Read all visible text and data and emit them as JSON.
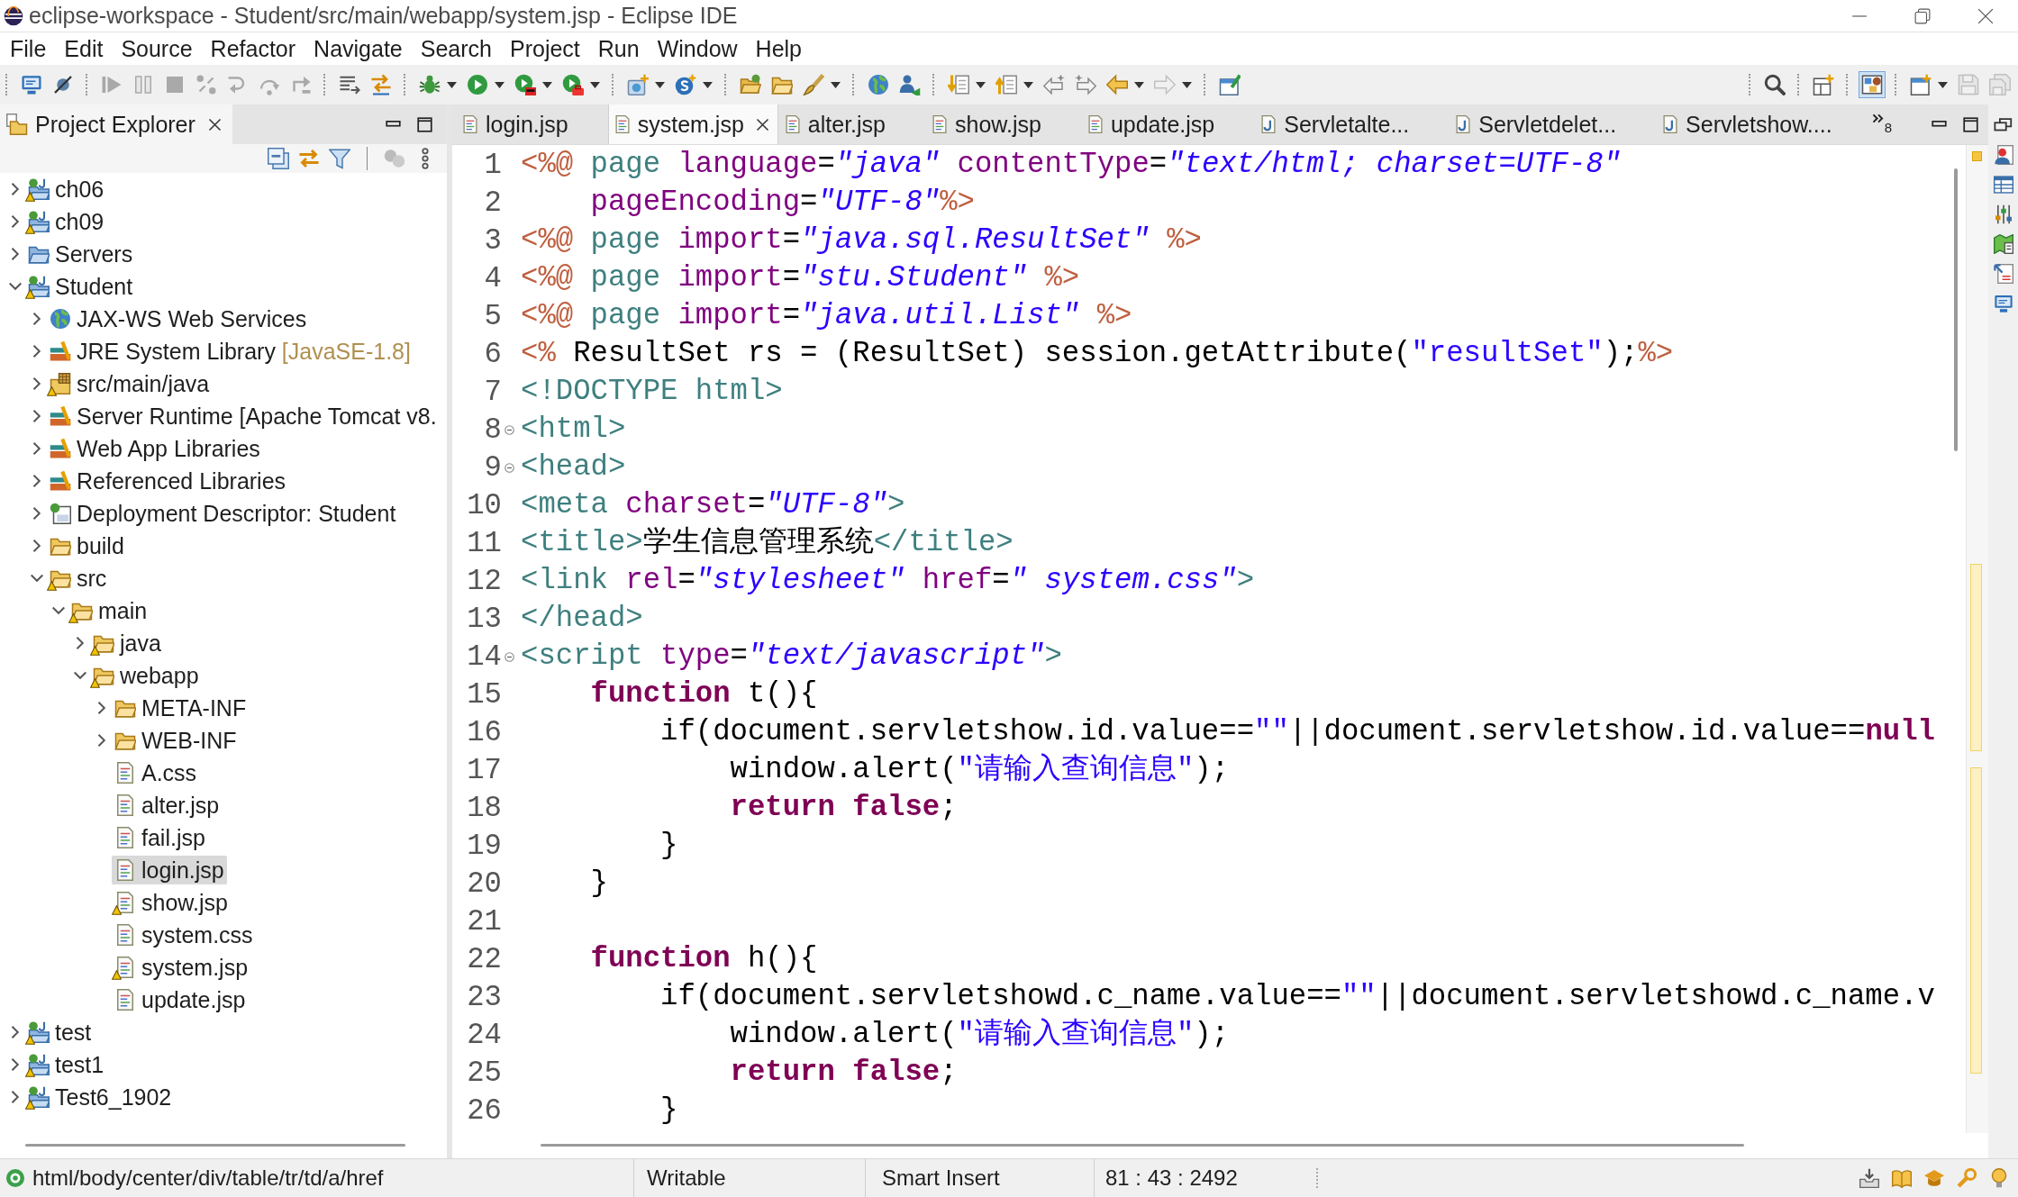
{
  "window": {
    "title": "eclipse-workspace - Student/src/main/webapp/system.jsp - Eclipse IDE"
  },
  "menu": [
    "File",
    "Edit",
    "Source",
    "Refactor",
    "Navigate",
    "Search",
    "Project",
    "Run",
    "Window",
    "Help"
  ],
  "toolbar": {
    "left": [
      [
        {
          "kind": "console",
          "disabled": false,
          "dropdown": false
        },
        {
          "kind": "skip-breakpoints",
          "disabled": false,
          "dropdown": false
        }
      ],
      [
        {
          "kind": "resume",
          "disabled": true,
          "dropdown": false
        },
        {
          "kind": "suspend",
          "disabled": true,
          "dropdown": false
        },
        {
          "kind": "terminate",
          "disabled": true,
          "dropdown": false
        },
        {
          "kind": "disconnect",
          "disabled": true,
          "dropdown": false
        },
        {
          "kind": "step-into",
          "disabled": true,
          "dropdown": false
        },
        {
          "kind": "step-over",
          "disabled": true,
          "dropdown": false
        },
        {
          "kind": "step-return",
          "disabled": true,
          "dropdown": false
        }
      ],
      [
        {
          "kind": "lines-arrow",
          "disabled": false,
          "dropdown": false
        },
        {
          "kind": "filter-arrows",
          "disabled": false,
          "dropdown": false
        }
      ],
      [
        {
          "kind": "debug",
          "disabled": false,
          "dropdown": true
        },
        {
          "kind": "run",
          "disabled": false,
          "dropdown": true
        },
        {
          "kind": "coverage",
          "disabled": false,
          "dropdown": true
        },
        {
          "kind": "tools",
          "disabled": false,
          "dropdown": true
        }
      ],
      [
        {
          "kind": "new-server",
          "disabled": false,
          "dropdown": true
        },
        {
          "kind": "new-s",
          "disabled": false,
          "dropdown": true
        }
      ],
      [
        {
          "kind": "folder-open",
          "disabled": false,
          "dropdown": false
        },
        {
          "kind": "folder",
          "disabled": false,
          "dropdown": false
        },
        {
          "kind": "brush",
          "disabled": false,
          "dropdown": true
        }
      ],
      [
        {
          "kind": "globe",
          "disabled": false,
          "dropdown": false
        },
        {
          "kind": "person-search",
          "disabled": false,
          "dropdown": false
        }
      ],
      [
        {
          "kind": "annot-down",
          "disabled": false,
          "dropdown": true
        },
        {
          "kind": "annot-up",
          "disabled": false,
          "dropdown": true
        },
        {
          "kind": "edit-back",
          "disabled": false,
          "dropdown": false
        },
        {
          "kind": "edit-fwd",
          "disabled": false,
          "dropdown": false
        },
        {
          "kind": "back",
          "disabled": false,
          "dropdown": true
        },
        {
          "kind": "forward",
          "disabled": true,
          "dropdown": true
        }
      ],
      [
        {
          "kind": "pin-window",
          "disabled": false,
          "dropdown": false
        }
      ]
    ],
    "right": [
      [
        {
          "kind": "search",
          "disabled": false,
          "dropdown": false,
          "selected": false
        }
      ],
      [
        {
          "kind": "perspective-open",
          "disabled": false,
          "dropdown": false,
          "selected": false
        }
      ],
      [
        {
          "kind": "jee",
          "disabled": false,
          "dropdown": false,
          "selected": true
        }
      ],
      [
        {
          "kind": "java-persp",
          "disabled": false,
          "dropdown": true,
          "selected": false
        },
        {
          "kind": "save",
          "disabled": true,
          "dropdown": false,
          "selected": false
        },
        {
          "kind": "save-all",
          "disabled": true,
          "dropdown": false,
          "selected": false
        }
      ]
    ]
  },
  "project_explorer": {
    "title": "Project Explorer"
  },
  "panel_toolbar": [
    [
      {
        "kind": "collapse-all",
        "disabled": false
      },
      {
        "kind": "link",
        "disabled": false
      },
      {
        "kind": "filter",
        "disabled": false
      }
    ],
    [
      {
        "kind": "sync",
        "disabled": true
      },
      {
        "kind": "view-menu",
        "disabled": false
      }
    ]
  ],
  "tree": [
    {
      "label": "ch06",
      "kind": "project",
      "warning": true,
      "expanded": false,
      "selected": false
    },
    {
      "label": "ch09",
      "kind": "project",
      "warning": true,
      "expanded": false,
      "selected": false
    },
    {
      "label": "Servers",
      "kind": "servers",
      "warning": false,
      "expanded": false,
      "selected": false
    },
    {
      "label": "Student",
      "kind": "project",
      "warning": true,
      "expanded": true,
      "selected": false,
      "children": [
        {
          "label": "JAX-WS Web Services",
          "kind": "web-services",
          "warning": false,
          "expanded": false,
          "selected": false
        },
        {
          "label": "JRE System Library",
          "decoration": "[JavaSE-1.8]",
          "kind": "library",
          "warning": false,
          "expanded": false,
          "selected": false
        },
        {
          "label": "src/main/java",
          "kind": "source-folder",
          "warning": true,
          "expanded": false,
          "selected": false
        },
        {
          "label": "Server Runtime [Apache Tomcat v8.",
          "kind": "library",
          "warning": false,
          "expanded": false,
          "selected": false
        },
        {
          "label": "Web App Libraries",
          "kind": "library",
          "warning": false,
          "expanded": false,
          "selected": false
        },
        {
          "label": "Referenced Libraries",
          "kind": "library",
          "warning": false,
          "expanded": false,
          "selected": false
        },
        {
          "label": "Deployment Descriptor: Student",
          "kind": "descriptor",
          "warning": false,
          "expanded": false,
          "selected": false
        },
        {
          "label": "build",
          "kind": "folder",
          "warning": false,
          "expanded": false,
          "selected": false
        },
        {
          "label": "src",
          "kind": "folder",
          "warning": true,
          "expanded": true,
          "selected": false,
          "children": [
            {
              "label": "main",
              "kind": "folder",
              "warning": true,
              "expanded": true,
              "selected": false,
              "children": [
                {
                  "label": "java",
                  "kind": "folder",
                  "warning": true,
                  "expanded": false,
                  "selected": false
                },
                {
                  "label": "webapp",
                  "kind": "folder",
                  "warning": true,
                  "expanded": true,
                  "selected": false,
                  "children": [
                    {
                      "label": "META-INF",
                      "kind": "folder",
                      "warning": false,
                      "expanded": false,
                      "selected": false
                    },
                    {
                      "label": "WEB-INF",
                      "kind": "folder",
                      "warning": false,
                      "expanded": false,
                      "selected": false
                    },
                    {
                      "label": "A.css",
                      "kind": "file",
                      "warning": false,
                      "selected": false
                    },
                    {
                      "label": "alter.jsp",
                      "kind": "file",
                      "warning": false,
                      "selected": false
                    },
                    {
                      "label": "fail.jsp",
                      "kind": "file",
                      "warning": false,
                      "selected": false
                    },
                    {
                      "label": "login.jsp",
                      "kind": "file",
                      "warning": false,
                      "selected": true
                    },
                    {
                      "label": "show.jsp",
                      "kind": "file",
                      "warning": true,
                      "selected": false
                    },
                    {
                      "label": "system.css",
                      "kind": "file",
                      "warning": false,
                      "selected": false
                    },
                    {
                      "label": "system.jsp",
                      "kind": "file",
                      "warning": true,
                      "selected": false
                    },
                    {
                      "label": "update.jsp",
                      "kind": "file",
                      "warning": false,
                      "selected": false
                    }
                  ]
                }
              ]
            }
          ]
        }
      ]
    },
    {
      "label": "test",
      "kind": "project",
      "warning": true,
      "expanded": false,
      "selected": false
    },
    {
      "label": "test1",
      "kind": "project",
      "warning": true,
      "expanded": false,
      "selected": false
    },
    {
      "label": "Test6_1902",
      "kind": "project",
      "warning": true,
      "expanded": false,
      "selected": false
    }
  ],
  "editor_tabs": [
    {
      "label": "login.jsp",
      "kind": "jsp",
      "selected": false
    },
    {
      "label": "system.jsp",
      "kind": "jsp",
      "selected": true
    },
    {
      "label": "alter.jsp",
      "kind": "jsp",
      "selected": false
    },
    {
      "label": "show.jsp",
      "kind": "jsp",
      "selected": false
    },
    {
      "label": "update.jsp",
      "kind": "jsp",
      "selected": false
    },
    {
      "label": "Servletalte...",
      "kind": "java",
      "selected": false
    },
    {
      "label": "Servletdelet...",
      "kind": "java",
      "selected": false
    },
    {
      "label": "Servletshow....",
      "kind": "java",
      "selected": false
    }
  ],
  "tab_overflow": "8",
  "editor": {
    "lines": [
      {
        "number": "1",
        "foldable": false,
        "tokens": [
          {
            "kind": "delim",
            "text": "<%@ "
          },
          {
            "kind": "tag",
            "text": "page "
          },
          {
            "kind": "attr",
            "text": "language"
          },
          {
            "kind": "text",
            "text": "="
          },
          {
            "kind": "value",
            "text": "\"java\" "
          },
          {
            "kind": "attr",
            "text": "contentType"
          },
          {
            "kind": "text",
            "text": "="
          },
          {
            "kind": "value",
            "text": "\"text/html; charset=UTF-8\""
          }
        ]
      },
      {
        "number": "2",
        "foldable": false,
        "tokens": [
          {
            "kind": "attr",
            "text": "    pageEncoding"
          },
          {
            "kind": "text",
            "text": "="
          },
          {
            "kind": "value",
            "text": "\"UTF-8\""
          },
          {
            "kind": "delim",
            "text": "%>"
          }
        ]
      },
      {
        "number": "3",
        "foldable": false,
        "tokens": [
          {
            "kind": "delim",
            "text": "<%@ "
          },
          {
            "kind": "tag",
            "text": "page "
          },
          {
            "kind": "attr",
            "text": "import"
          },
          {
            "kind": "text",
            "text": "="
          },
          {
            "kind": "value",
            "text": "\"java.sql.ResultSet\" "
          },
          {
            "kind": "delim",
            "text": "%>"
          }
        ]
      },
      {
        "number": "4",
        "foldable": false,
        "tokens": [
          {
            "kind": "delim",
            "text": "<%@ "
          },
          {
            "kind": "tag",
            "text": "page "
          },
          {
            "kind": "attr",
            "text": "import"
          },
          {
            "kind": "text",
            "text": "="
          },
          {
            "kind": "value",
            "text": "\"stu.Student\" "
          },
          {
            "kind": "delim",
            "text": "%>"
          }
        ]
      },
      {
        "number": "5",
        "foldable": false,
        "tokens": [
          {
            "kind": "delim",
            "text": "<%@ "
          },
          {
            "kind": "tag",
            "text": "page "
          },
          {
            "kind": "attr",
            "text": "import"
          },
          {
            "kind": "text",
            "text": "="
          },
          {
            "kind": "value",
            "text": "\"java.util.List\" "
          },
          {
            "kind": "delim",
            "text": "%>"
          }
        ]
      },
      {
        "number": "6",
        "foldable": false,
        "tokens": [
          {
            "kind": "delim",
            "text": "<%"
          },
          {
            "kind": "text",
            "text": " ResultSet rs = (ResultSet) session.getAttribute("
          },
          {
            "kind": "string",
            "text": "\"resultSet\""
          },
          {
            "kind": "text",
            "text": ");"
          },
          {
            "kind": "delim",
            "text": "%>"
          }
        ]
      },
      {
        "number": "7",
        "foldable": false,
        "tokens": [
          {
            "kind": "tag",
            "text": "<!DOCTYPE html>"
          }
        ]
      },
      {
        "number": "8",
        "foldable": true,
        "tokens": [
          {
            "kind": "tag",
            "text": "<html>"
          }
        ]
      },
      {
        "number": "9",
        "foldable": true,
        "tokens": [
          {
            "kind": "tag",
            "text": "<head>"
          }
        ]
      },
      {
        "number": "10",
        "foldable": false,
        "tokens": [
          {
            "kind": "tag",
            "text": "<meta "
          },
          {
            "kind": "attr",
            "text": "charset"
          },
          {
            "kind": "text",
            "text": "="
          },
          {
            "kind": "value",
            "text": "\"UTF-8\""
          },
          {
            "kind": "tag",
            "text": ">"
          }
        ]
      },
      {
        "number": "11",
        "foldable": false,
        "tokens": [
          {
            "kind": "tag",
            "text": "<title>"
          },
          {
            "kind": "text",
            "text": "学生信息管理系统"
          },
          {
            "kind": "tag",
            "text": "</title>"
          }
        ]
      },
      {
        "number": "12",
        "foldable": false,
        "tokens": [
          {
            "kind": "tag",
            "text": "<link "
          },
          {
            "kind": "attr",
            "text": "rel"
          },
          {
            "kind": "text",
            "text": "="
          },
          {
            "kind": "value",
            "text": "\"stylesheet\" "
          },
          {
            "kind": "attr",
            "text": "href"
          },
          {
            "kind": "text",
            "text": "="
          },
          {
            "kind": "value",
            "text": "\" system.css\""
          },
          {
            "kind": "tag",
            "text": ">"
          }
        ]
      },
      {
        "number": "13",
        "foldable": false,
        "tokens": [
          {
            "kind": "tag",
            "text": "</head>"
          }
        ]
      },
      {
        "number": "14",
        "foldable": true,
        "tokens": [
          {
            "kind": "tag",
            "text": "<script "
          },
          {
            "kind": "attr",
            "text": "type"
          },
          {
            "kind": "text",
            "text": "="
          },
          {
            "kind": "value",
            "text": "\"text/javascript\""
          },
          {
            "kind": "tag",
            "text": ">"
          }
        ]
      },
      {
        "number": "15",
        "foldable": false,
        "tokens": [
          {
            "kind": "keyword",
            "text": "    function"
          },
          {
            "kind": "text",
            "text": " t(){"
          }
        ]
      },
      {
        "number": "16",
        "foldable": false,
        "tokens": [
          {
            "kind": "text",
            "text": "        if(document.servletshow.id.value=="
          },
          {
            "kind": "string",
            "text": "\"\""
          },
          {
            "kind": "text",
            "text": "||document.servletshow.id.value=="
          },
          {
            "kind": "keyword",
            "text": "null"
          }
        ]
      },
      {
        "number": "17",
        "foldable": false,
        "tokens": [
          {
            "kind": "text",
            "text": "            window.alert("
          },
          {
            "kind": "string",
            "text": "\"请输入查询信息\""
          },
          {
            "kind": "text",
            "text": ");"
          }
        ]
      },
      {
        "number": "18",
        "foldable": false,
        "tokens": [
          {
            "kind": "keyword",
            "text": "            return false"
          },
          {
            "kind": "text",
            "text": ";"
          }
        ]
      },
      {
        "number": "19",
        "foldable": false,
        "tokens": [
          {
            "kind": "text",
            "text": "        }"
          }
        ]
      },
      {
        "number": "20",
        "foldable": false,
        "tokens": [
          {
            "kind": "text",
            "text": "    }"
          }
        ]
      },
      {
        "number": "21",
        "foldable": false
      },
      {
        "number": "22",
        "foldable": false,
        "tokens": [
          {
            "kind": "keyword",
            "text": "    function"
          },
          {
            "kind": "text",
            "text": " h(){"
          }
        ]
      },
      {
        "number": "23",
        "foldable": false,
        "tokens": [
          {
            "kind": "text",
            "text": "        if(document.servletshowd.c_name.value=="
          },
          {
            "kind": "string",
            "text": "\"\""
          },
          {
            "kind": "text",
            "text": "||document.servletshowd.c_name.v"
          }
        ]
      },
      {
        "number": "24",
        "foldable": false,
        "tokens": [
          {
            "kind": "text",
            "text": "            window.alert("
          },
          {
            "kind": "string",
            "text": "\"请输入查询信息\""
          },
          {
            "kind": "text",
            "text": ");"
          }
        ]
      },
      {
        "number": "25",
        "foldable": false,
        "tokens": [
          {
            "kind": "keyword",
            "text": "            return false"
          },
          {
            "kind": "text",
            "text": ";"
          }
        ]
      },
      {
        "number": "26",
        "foldable": false,
        "tokens": [
          {
            "kind": "text",
            "text": "        }"
          }
        ]
      }
    ]
  },
  "status_bar": {
    "path": "html/body/center/div/table/tr/td/a/href",
    "mode": "Writable",
    "insert": "Smart Insert",
    "position": "81 : 43 : 2492"
  }
}
